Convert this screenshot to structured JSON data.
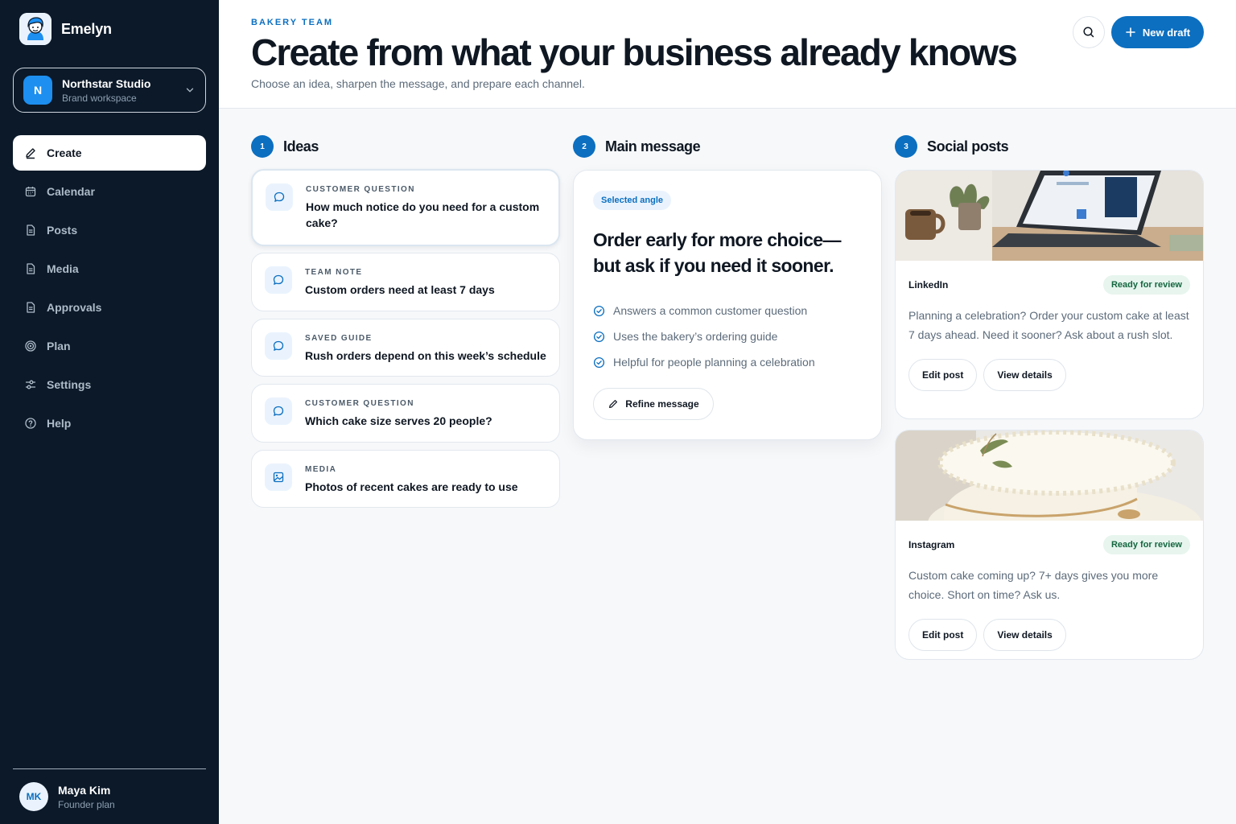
{
  "app": {
    "name": "Emelyn"
  },
  "workspace": {
    "initial": "N",
    "name": "Northstar Studio",
    "subtitle": "Brand workspace"
  },
  "nav": [
    {
      "label": "Create",
      "icon": "pencil-icon",
      "active": true
    },
    {
      "label": "Calendar",
      "icon": "calendar-icon"
    },
    {
      "label": "Posts",
      "icon": "document-icon"
    },
    {
      "label": "Media",
      "icon": "document-icon"
    },
    {
      "label": "Approvals",
      "icon": "document-icon"
    },
    {
      "label": "Plan",
      "icon": "target-icon"
    },
    {
      "label": "Settings",
      "icon": "sliders-icon"
    },
    {
      "label": "Help",
      "icon": "help-icon"
    }
  ],
  "user": {
    "initials": "MK",
    "name": "Maya Kim",
    "plan": "Founder plan"
  },
  "header": {
    "eyebrow": "BAKERY TEAM",
    "title": "Create from what your business already knows",
    "subtitle": "Choose an idea, sharpen the message, and prepare each channel.",
    "new_draft": "New draft"
  },
  "columns": [
    {
      "step": "1",
      "title": "Ideas"
    },
    {
      "step": "2",
      "title": "Main message"
    },
    {
      "step": "3",
      "title": "Social posts"
    }
  ],
  "ideas": [
    {
      "kind": "CUSTOMER QUESTION",
      "text": "How much notice do you need for a custom cake?",
      "icon": "chat-icon",
      "selected": true
    },
    {
      "kind": "TEAM NOTE",
      "text": "Custom orders need at least 7 days",
      "icon": "chat-icon"
    },
    {
      "kind": "SAVED GUIDE",
      "text": "Rush orders depend on this week’s schedule",
      "icon": "chat-icon"
    },
    {
      "kind": "CUSTOMER QUESTION",
      "text": "Which cake size serves 20 people?",
      "icon": "chat-icon"
    },
    {
      "kind": "MEDIA",
      "text": "Photos of recent cakes are ready to use",
      "icon": "image-icon"
    }
  ],
  "message": {
    "badge": "Selected angle",
    "headline": "Order early for more choice—but ask if you need it sooner.",
    "checks": [
      "Answers a common customer question",
      "Uses the bakery’s ordering guide",
      "Helpful for people planning a celebration"
    ],
    "refine": "Refine message"
  },
  "posts": [
    {
      "platform": "LinkedIn",
      "status": "Ready for review",
      "body": "Planning a celebration? Order your custom cake at least 7 days ahead. Need it sooner? Ask about a rush slot.",
      "edit": "Edit post",
      "details": "View details"
    },
    {
      "platform": "Instagram",
      "status": "Ready for review",
      "body": "Custom cake coming up? 7+ days gives you more choice. Short on time? Ask us.",
      "edit": "Edit post",
      "details": "View details"
    }
  ],
  "colors": {
    "accent": "#0c6fc0",
    "sidebar": "#0b1929",
    "ready": "#14663f"
  }
}
